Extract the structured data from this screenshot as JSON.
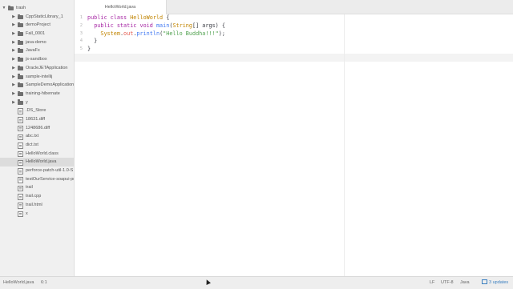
{
  "tree": [
    {
      "label": "trash",
      "type": "folder",
      "expanded": true,
      "depth": 0
    },
    {
      "label": "CppStaticLibrary_1",
      "type": "folder",
      "depth": 1
    },
    {
      "label": "demoProject",
      "type": "folder",
      "depth": 1
    },
    {
      "label": "Fall_0001",
      "type": "folder",
      "depth": 1
    },
    {
      "label": "java-demo",
      "type": "folder",
      "depth": 1
    },
    {
      "label": "JavaFx",
      "type": "folder",
      "depth": 1
    },
    {
      "label": "js-sandbox",
      "type": "folder",
      "depth": 1
    },
    {
      "label": "OracleJETApplication",
      "type": "folder",
      "depth": 1
    },
    {
      "label": "sample-intellij",
      "type": "folder",
      "depth": 1
    },
    {
      "label": "SampleDemoApplication",
      "type": "folder",
      "depth": 1
    },
    {
      "label": "training-hibernate",
      "type": "folder",
      "depth": 1
    },
    {
      "label": "y",
      "type": "folder",
      "depth": 1
    },
    {
      "label": ".DS_Store",
      "type": "file",
      "depth": 1
    },
    {
      "label": "18631.diff",
      "type": "file",
      "depth": 1
    },
    {
      "label": "1248686.diff",
      "type": "file",
      "depth": 1
    },
    {
      "label": "abc.txt",
      "type": "file",
      "depth": 1
    },
    {
      "label": "dict.txt",
      "type": "file",
      "depth": 1
    },
    {
      "label": "HelloWorld.class",
      "type": "file",
      "depth": 1
    },
    {
      "label": "HelloWorld.java",
      "type": "file",
      "depth": 1,
      "selected": true
    },
    {
      "label": "perforce-patch-util-1.0-S",
      "type": "file",
      "depth": 1
    },
    {
      "label": "testOurService-soapui-pr",
      "type": "file",
      "depth": 1
    },
    {
      "label": "trail",
      "type": "file",
      "depth": 1
    },
    {
      "label": "trail.cpp",
      "type": "file",
      "depth": 1
    },
    {
      "label": "trail.html",
      "type": "file",
      "depth": 1
    },
    {
      "label": "x",
      "type": "file",
      "depth": 1
    }
  ],
  "tab": {
    "title": "HelloWorld.java"
  },
  "editor": {
    "line_numbers": [
      "1",
      "2",
      "3",
      "4",
      "5",
      "6"
    ],
    "cursor_line": 6,
    "lines": [
      [
        [
          "kw",
          "public "
        ],
        [
          "kw",
          "class "
        ],
        [
          "ty",
          "HelloWorld "
        ],
        [
          "pl",
          "{"
        ]
      ],
      [
        [
          "pl",
          "  "
        ],
        [
          "kw",
          "public "
        ],
        [
          "kw",
          "static "
        ],
        [
          "kw",
          "void "
        ],
        [
          "fn",
          "main"
        ],
        [
          "pl",
          "("
        ],
        [
          "ty",
          "String"
        ],
        [
          "pl",
          "[] args) {"
        ]
      ],
      [
        [
          "pl",
          "    "
        ],
        [
          "ty",
          "System"
        ],
        [
          "pl",
          "."
        ],
        [
          "id",
          "out"
        ],
        [
          "pl",
          "."
        ],
        [
          "fn",
          "println"
        ],
        [
          "pl",
          "("
        ],
        [
          "str",
          "\"Hello Buddha!!!\""
        ],
        [
          "pl",
          ");"
        ]
      ],
      [
        [
          "pl",
          "  }"
        ]
      ],
      [
        [
          "pl",
          "}"
        ]
      ],
      []
    ]
  },
  "status": {
    "file": "HelloWorld.java",
    "position": "6:1",
    "line_ending": "LF",
    "encoding": "UTF-8",
    "grammar": "Java",
    "updates": "3 updates"
  },
  "colors": {
    "keyword": "#a626a4",
    "type": "#c18401",
    "function": "#4078f2",
    "identifier": "#e45649",
    "string": "#50a14f",
    "accent": "#3a7fc0"
  }
}
